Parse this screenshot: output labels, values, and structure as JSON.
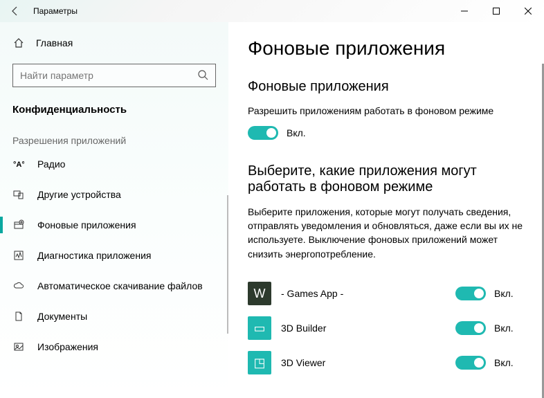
{
  "titlebar": {
    "title": "Параметры"
  },
  "sidebar": {
    "home": "Главная",
    "search_placeholder": "Найти параметр",
    "category": "Конфиденциальность",
    "group_label": "Разрешения приложений",
    "items": [
      {
        "label": "Радио",
        "active": false
      },
      {
        "label": "Другие устройства",
        "active": false
      },
      {
        "label": "Фоновые приложения",
        "active": true
      },
      {
        "label": "Диагностика приложения",
        "active": false
      },
      {
        "label": "Автоматическое скачивание файлов",
        "active": false
      },
      {
        "label": "Документы",
        "active": false
      },
      {
        "label": "Изображения",
        "active": false
      }
    ]
  },
  "main": {
    "heading": "Фоновые приложения",
    "section1_title": "Фоновые приложения",
    "section1_sub": "Разрешить приложениям работать в фоновом режиме",
    "toggle_on_label": "Вкл.",
    "section2_title": "Выберите, какие приложения могут работать в фоновом режиме",
    "section2_desc": "Выберите приложения, которые могут получать сведения, отправлять уведомления и обновляться, даже если вы их не используете. Выключение фоновых приложений может снизить энергопотребление.",
    "apps": [
      {
        "name": "- Games App -",
        "icon_bg": "#2d3a2d",
        "icon_glyph": "W",
        "on": "Вкл."
      },
      {
        "name": "3D Builder",
        "icon_bg": "#1fb9b1",
        "icon_glyph": "▭",
        "on": "Вкл."
      },
      {
        "name": "3D Viewer",
        "icon_bg": "#1fb9b1",
        "icon_glyph": "◳",
        "on": "Вкл."
      }
    ]
  }
}
